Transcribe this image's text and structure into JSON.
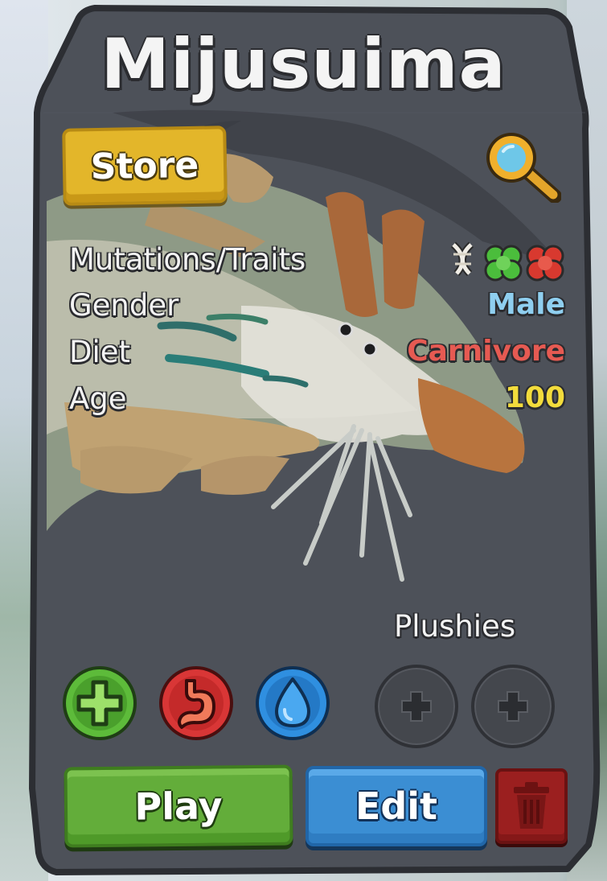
{
  "creature": {
    "name": "Mijusuima"
  },
  "buttons": {
    "store": "Store",
    "play": "Play",
    "edit": "Edit"
  },
  "stats": {
    "rows": [
      {
        "label": "Mutations/Traits",
        "value": ""
      },
      {
        "label": "Gender",
        "value": "Male",
        "color": "#8fcff0"
      },
      {
        "label": "Diet",
        "value": "Carnivore",
        "color": "#e65a52"
      },
      {
        "label": "Age",
        "value": "100",
        "color": "#f3dc3c"
      }
    ],
    "trait_icons": [
      "bones-trait-icon",
      "green-cells-trait-icon",
      "red-cells-trait-icon"
    ]
  },
  "actions": {
    "icons": [
      "heal-plus-icon",
      "stomach-icon",
      "water-drop-icon"
    ],
    "colors": {
      "heal": "#5dbb3a",
      "food": "#d93636",
      "water": "#2f8fe0"
    }
  },
  "plushies": {
    "label": "Plushies",
    "slots": 2
  },
  "theme": {
    "card_bg": "#4d5159",
    "card_border": "#2c2e33",
    "play": "#63ad3a",
    "edit": "#3b8ed3",
    "store": "#e3b62a",
    "trash": "#9b1f1f"
  }
}
